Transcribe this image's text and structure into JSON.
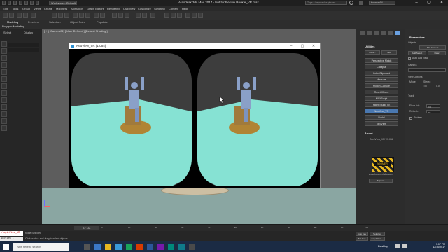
{
  "titlebar": {
    "workspace": "Workspace: Default",
    "title": "Autodesk 3ds Max 2017 - Not for Resale   Rookie_VR.max",
    "search_placeholder": "Type a keyword or phrase",
    "user": "boonear14"
  },
  "menubar": {
    "items": [
      "Edit",
      "Tools",
      "Group",
      "Views",
      "Create",
      "Modifiers",
      "Animation",
      "Graph Editors",
      "Rendering",
      "Civil View",
      "Customize",
      "Scripting",
      "Content",
      "Help"
    ]
  },
  "ribbon": {
    "tabs": [
      "Modeling",
      "Freeform",
      "Selection",
      "Object Paint",
      "Populate"
    ],
    "subtitle": "Polygon Modeling"
  },
  "scene_explorer": {
    "tabs": [
      "Select",
      "Display"
    ]
  },
  "viewport": {
    "label": "[ + ] [Camera01] [ User Defined ] [Default Shading ]"
  },
  "vr_window": {
    "title": "NeoView_VR (1.064)"
  },
  "command_panel": {
    "utilities_title": "Utilities",
    "more_label": "More...",
    "sets_label": "Sets",
    "buttons": [
      "Perspective Match",
      "Collapse",
      "Color Clipboard",
      "Measure",
      "Motion Capture",
      "Reset XForm",
      "MAXScript",
      "Flight Studio (c)",
      "NeoView_VR",
      "Nodal",
      "NeoView"
    ],
    "selected_button": "NeoView_VR",
    "about_title": "About",
    "about_text": "NeoView_VR V1.066",
    "logo_text": "BOOMER",
    "website": "www.boomerlabs.com",
    "support_label": "Support"
  },
  "parameters": {
    "title": "Parameters",
    "objects_label": "Objects",
    "add_camera": "Add Camera",
    "add_select": "Add Select",
    "clear": "Clear",
    "auto_add": "Auto Add New",
    "camera_label": "Camera",
    "view_options": "View Options",
    "mode_label": "Mode:",
    "mode_value": "Stereo",
    "tilt_label": "Tilt",
    "tilt_value": "0.0",
    "track_label": "Track",
    "floor_adj": "Floor Adj:",
    "floor_adj_value": "0.0",
    "refresh_label": "Refresh:",
    "refresh_value": "60",
    "redraw_label": "Redraw"
  },
  "timeline": {
    "frame_label": "0 / 100",
    "ticks": [
      "0",
      "10",
      "20",
      "30",
      "40",
      "50",
      "60",
      "70",
      "80",
      "90",
      "100"
    ]
  },
  "status": {
    "maxscript": "pluginView_VR",
    "maxscript2": "Neoview - Initia",
    "selection": "None Selected",
    "prompt": "Click or click-and-drag to select objects",
    "auto_key": "Auto Key",
    "set_key": "Set Key",
    "selected": "Selected",
    "key_filters": "Key Filters..."
  },
  "taskbar": {
    "search_placeholder": "Type here to search",
    "desktop_label": "Desktop",
    "time": "7:07 PM",
    "date": "12/30/2017"
  }
}
